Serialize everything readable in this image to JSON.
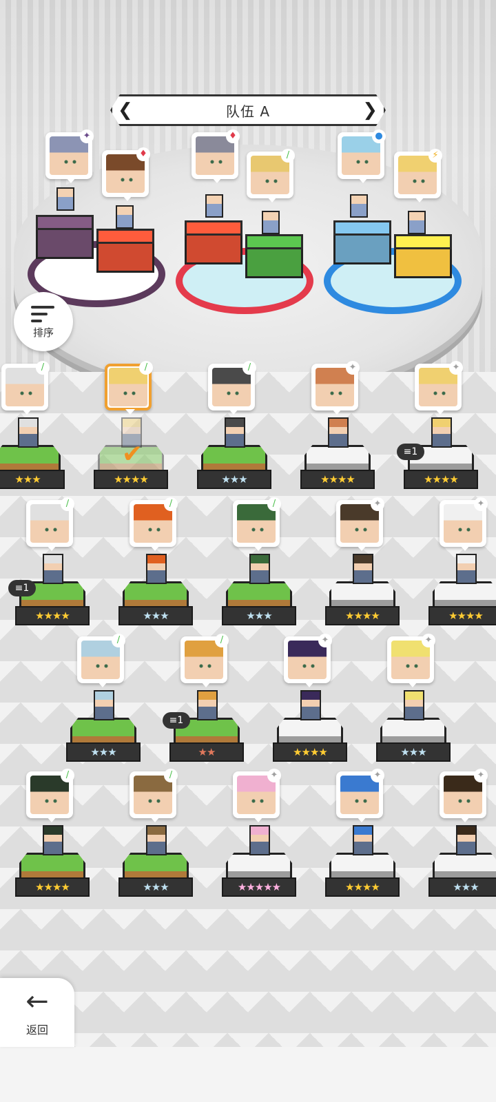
{
  "team": {
    "title": "队伍 A",
    "prev_arrow": "❮",
    "next_arrow": "❯"
  },
  "sort_button": {
    "label": "排序"
  },
  "back_button": {
    "label": "返回",
    "arrow": "←"
  },
  "formation": [
    {
      "slot": "back-left",
      "hair": "#8c94b4",
      "element": "✦",
      "element_color": "#6a4a8a"
    },
    {
      "slot": "front-left",
      "hair": "#7a4a2a",
      "element": "♦",
      "element_color": "#e03a4a"
    },
    {
      "slot": "back-center",
      "hair": "#8a8a9a",
      "element": "♦",
      "element_color": "#e03a4a"
    },
    {
      "slot": "front-center",
      "hair": "#e8c870",
      "element": "/",
      "element_color": "#4abf4a"
    },
    {
      "slot": "back-right",
      "hair": "#9ad0e8",
      "element": "●",
      "element_color": "#2e8ae0"
    },
    {
      "slot": "front-right",
      "hair": "#f0d070",
      "element": "⚡",
      "element_color": "#f0b020"
    }
  ],
  "roster": [
    {
      "hair": "#e0e0e0",
      "element": "/",
      "pedestal": "grass",
      "stars": "★★★",
      "star_tier": "gold",
      "dup": ""
    },
    {
      "hair": "#f0d070",
      "element": "/",
      "pedestal": "grass",
      "stars": "★★★★",
      "star_tier": "gold",
      "dup": "",
      "selected": true
    },
    {
      "hair": "#4a4a4a",
      "element": "/",
      "pedestal": "grass",
      "stars": "★★★",
      "star_tier": "silver",
      "dup": ""
    },
    {
      "hair": "#d08050",
      "element": "✦",
      "pedestal": "stone",
      "stars": "★★★★",
      "star_tier": "gold",
      "dup": ""
    },
    {
      "hair": "#f0d070",
      "element": "✦",
      "pedestal": "stone",
      "stars": "★★★★",
      "star_tier": "gold",
      "dup": "1"
    },
    {
      "hair": "#e0e0e0",
      "element": "/",
      "pedestal": "grass",
      "stars": "★★★★",
      "star_tier": "gold",
      "dup": "1"
    },
    {
      "hair": "#e06020",
      "element": "/",
      "pedestal": "grass",
      "stars": "★★★",
      "star_tier": "silver",
      "dup": ""
    },
    {
      "hair": "#3a6a3a",
      "element": "/",
      "pedestal": "grass",
      "stars": "★★★",
      "star_tier": "silver",
      "dup": ""
    },
    {
      "hair": "#4a3a2a",
      "element": "✦",
      "pedestal": "stone",
      "stars": "★★★★",
      "star_tier": "gold",
      "dup": ""
    },
    {
      "hair": "#f0f0f0",
      "element": "✦",
      "pedestal": "stone",
      "stars": "★★★★",
      "star_tier": "gold",
      "dup": ""
    },
    {
      "hair": "#b0d0e0",
      "element": "/",
      "pedestal": "grass",
      "stars": "★★★",
      "star_tier": "silver",
      "dup": ""
    },
    {
      "hair": "#e0a040",
      "element": "/",
      "pedestal": "grass",
      "stars": "★★",
      "star_tier": "bronze",
      "dup": "1"
    },
    {
      "hair": "#3a2a5a",
      "element": "✦",
      "pedestal": "stone",
      "stars": "★★★★",
      "star_tier": "gold",
      "dup": ""
    },
    {
      "hair": "#f0e070",
      "element": "✦",
      "pedestal": "stone",
      "stars": "★★★",
      "star_tier": "silver",
      "dup": ""
    },
    {
      "hair": "#2a3a2a",
      "element": "/",
      "pedestal": "grass",
      "stars": "★★★★",
      "star_tier": "gold",
      "dup": ""
    },
    {
      "hair": "#8a6a40",
      "element": "/",
      "pedestal": "grass",
      "stars": "★★★",
      "star_tier": "silver",
      "dup": ""
    },
    {
      "hair": "#f0b0d0",
      "element": "✦",
      "pedestal": "stone",
      "stars": "★★★★★",
      "star_tier": "rainbow",
      "dup": ""
    },
    {
      "hair": "#3a7ad0",
      "element": "✦",
      "pedestal": "stone",
      "stars": "★★★★",
      "star_tier": "gold",
      "dup": ""
    },
    {
      "hair": "#3a2a1a",
      "element": "✦",
      "pedestal": "stone",
      "stars": "★★★",
      "star_tier": "silver",
      "dup": ""
    }
  ]
}
